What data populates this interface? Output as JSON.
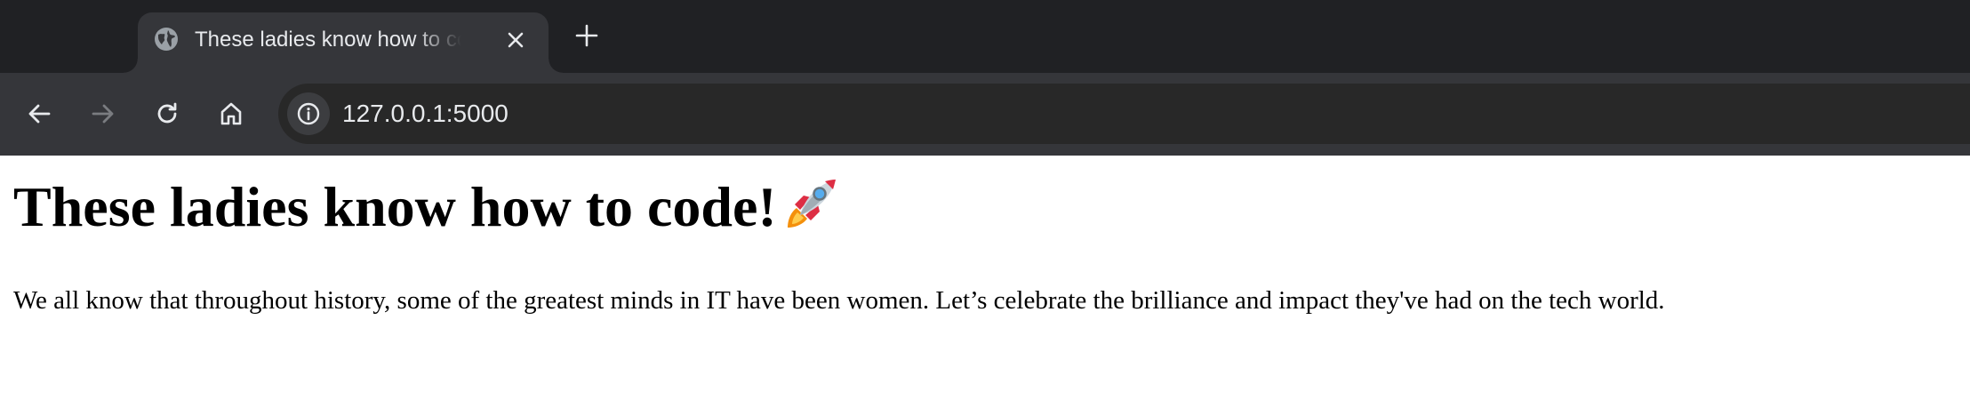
{
  "browser": {
    "tab": {
      "title": "These ladies know how to code!",
      "favicon": "globe-icon"
    },
    "new_tab_icon": "plus-icon",
    "toolbar": {
      "back_icon": "arrow-left-icon",
      "forward_icon": "arrow-right-icon",
      "reload_icon": "reload-icon",
      "home_icon": "home-icon",
      "site_info_icon": "info-icon",
      "url": "127.0.0.1:5000"
    }
  },
  "page": {
    "heading": "These ladies know how to code!",
    "heading_emoji": "rocket-icon",
    "paragraph": "We all know that throughout history, some of the greatest minds in IT have been women. Let’s celebrate the brilliance and impact they've had on the tech world."
  },
  "colors": {
    "tabstrip_bg": "#202124",
    "toolbar_bg": "#35363a",
    "omnibox_bg": "#282828",
    "text_light": "#e8eaed",
    "page_bg": "#ffffff",
    "page_text": "#000000"
  }
}
